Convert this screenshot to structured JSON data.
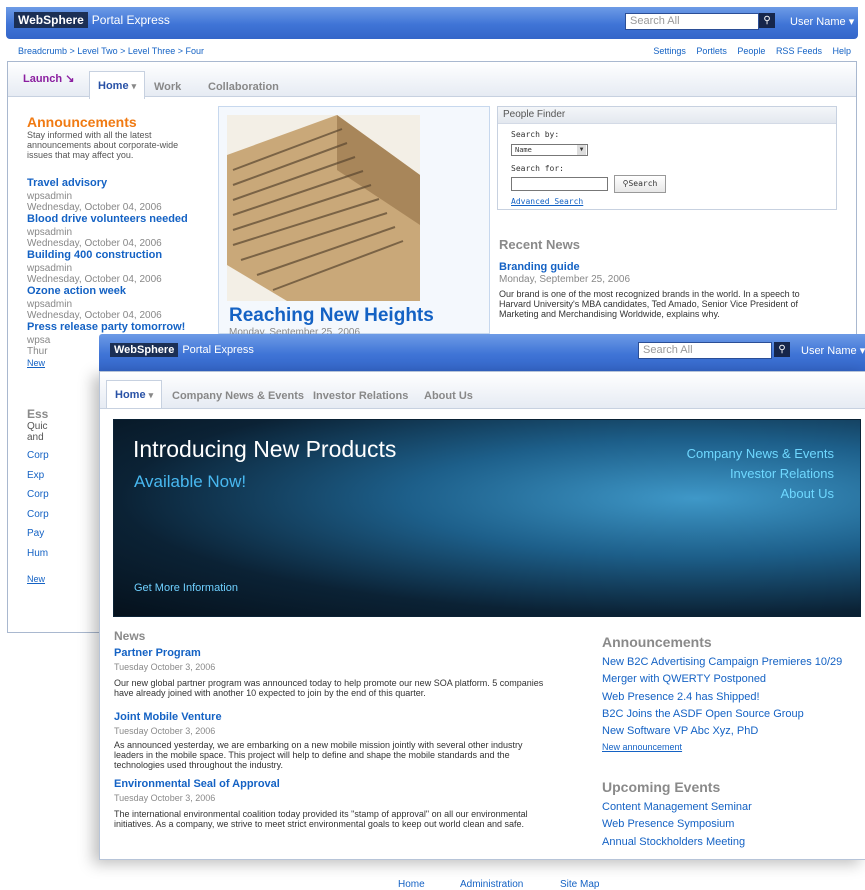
{
  "back_window": {
    "brand": {
      "websphere": "WebSphere",
      "product": "Portal Express"
    },
    "search_placeholder": "Search All",
    "user_menu": "User Name",
    "breadcrumb": "Breadcrumb > Level Two > Level Three > Four",
    "utility_links": [
      "Settings",
      "Portlets",
      "People",
      "RSS Feeds",
      "Help"
    ],
    "launch_label": "Launch",
    "tabs": [
      "Home",
      "Work",
      "Collaboration"
    ],
    "announcements": {
      "title": "Announcements",
      "intro": "Stay informed with all the latest announcements about corporate-wide issues that may affect you.",
      "items": [
        {
          "title": "Travel advisory",
          "author": "wpsadmin",
          "date": "Wednesday, October 04, 2006"
        },
        {
          "title": "Blood drive volunteers needed",
          "author": "wpsadmin",
          "date": "Wednesday, October 04, 2006"
        },
        {
          "title": "Building 400 construction",
          "author": "wpsadmin",
          "date": "Wednesday, October 04, 2006"
        },
        {
          "title": "Ozone action week",
          "author": "wpsadmin",
          "date": "Wednesday, October 04, 2006"
        },
        {
          "title": "Press release party tomorrow!",
          "author": "wpsa",
          "date": "Thur"
        }
      ],
      "new_link": "New"
    },
    "essentials": {
      "title": "Ess",
      "intro": [
        "Quic",
        "and"
      ],
      "links": [
        "Corp",
        "Exp",
        "Corp",
        "Corp",
        "Pay",
        "Hum"
      ],
      "new_link": "New"
    },
    "feature": {
      "title": "Reaching New Heights",
      "date": "Monday, September 25, 2006"
    },
    "people_finder": {
      "title": "People Finder",
      "search_by_label": "Search by:",
      "search_by_value": "Name",
      "search_for_label": "Search for:",
      "search_button": "Search",
      "advanced_link": "Advanced Search"
    },
    "recent_news": {
      "title": "Recent News",
      "item_title": "Branding guide",
      "item_date": "Monday, September 25, 2006",
      "item_body": "Our brand is one of the most recognized brands in the world. In a speech to Harvard University's MBA candidates, Ted Amado, Senior Vice President of Marketing and Merchandising Worldwide, explains why."
    }
  },
  "front_window": {
    "brand": {
      "websphere": "WebSphere",
      "product": "Portal Express"
    },
    "search_placeholder": "Search All",
    "user_menu": "User Name",
    "tabs": [
      "Home",
      "Company News & Events",
      "Investor Relations",
      "About Us"
    ],
    "hero": {
      "title": "Introducing New Products",
      "subtitle": "Available Now!",
      "cta": "Get More Information",
      "links": [
        "Company News & Events",
        "Investor Relations",
        "About Us"
      ]
    },
    "news": {
      "title": "News",
      "items": [
        {
          "title": "Partner Program",
          "date": "Tuesday October 3, 2006",
          "body": "Our new global partner program was announced today to help promote our new SOA platform. 5 companies have already joined with another 10 expected to join by the end of this quarter."
        },
        {
          "title": "Joint Mobile Venture",
          "date": "Tuesday October 3, 2006",
          "body": "As announced yesterday, we are embarking on a new mobile mission jointly with several other industry leaders in the mobile space. This project will help to define and shape the mobile standards and the technologies used throughout the industry."
        },
        {
          "title": "Environmental Seal of Approval",
          "date": "Tuesday October 3, 2006",
          "body": "The international environmental coalition today provided its \"stamp of approval\" on all our environmental initiatives. As a  company, we strive to meet strict environmental goals to keep out world clean and safe."
        }
      ]
    },
    "announcements": {
      "title": "Announcements",
      "items": [
        "New B2C Advertising Campaign Premieres 10/29",
        "Merger with QWERTY Postponed",
        "Web Presence 2.4 has Shipped!",
        "B2C Joins the ASDF Open Source Group",
        "New Software VP Abc Xyz, PhD"
      ],
      "new_link": "New announcement"
    },
    "events": {
      "title": "Upcoming Events",
      "items": [
        "Content Management Seminar",
        "Web Presence Symposium",
        "Annual Stockholders Meeting"
      ]
    }
  },
  "footer": [
    "Home",
    "Administration",
    "Site Map"
  ]
}
